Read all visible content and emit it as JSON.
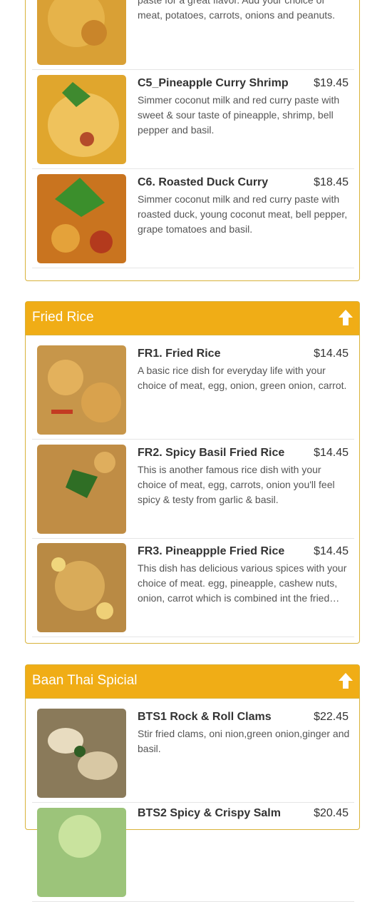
{
  "curry_partial": {
    "items": [
      {
        "desc": "Simmer coconut milk and massaman curry paste for a great flavor. Add your choice of meat, potatoes, carrots, onions and peanuts."
      },
      {
        "name": "C5_Pineapple Curry Shrimp",
        "price": "$19.45",
        "desc": "Simmer coconut milk and red curry paste with sweet & sour taste of pineapple, shrimp, bell pepper and basil."
      },
      {
        "name": "C6. Roasted Duck Curry",
        "price": "$18.45",
        "desc": "Simmer coconut milk and red curry paste with roasted duck, young coconut meat, bell pepper, grape tomatoes and basil."
      }
    ]
  },
  "fried_rice": {
    "title": "Fried Rice",
    "items": [
      {
        "name": "FR1. Fried Rice",
        "price": "$14.45",
        "desc": "A basic rice dish for everyday life with your choice of meat, egg, onion, green onion, carrot."
      },
      {
        "name": "FR2. Spicy Basil Fried Rice",
        "price": "$14.45",
        "desc": "This is another famous rice dish with your choice of meat, egg, carrots, onion you'll feel spicy & testy from garlic & basil."
      },
      {
        "name": "FR3. Pineappple Fried Rice",
        "price": "$14.45",
        "desc": "This dish has delicious various spices with your choice of meat. egg, pineapple, cashew nuts, onion, carrot which is combined int the fried…"
      }
    ]
  },
  "special": {
    "title": "Baan Thai Spicial",
    "items": [
      {
        "name": "BTS1 Rock & Roll Clams",
        "price": "$22.45",
        "desc": "Stir fried clams, oni nion,green onion,ginger and basil."
      },
      {
        "name": "BTS2 Spicy & Crispy Salm",
        "price": "$20.45",
        "desc": ""
      }
    ]
  },
  "colors": {
    "header": "#f0ad16",
    "border": "#d8b23a"
  },
  "icons": {
    "scroll_up": "arrow-up-icon"
  }
}
